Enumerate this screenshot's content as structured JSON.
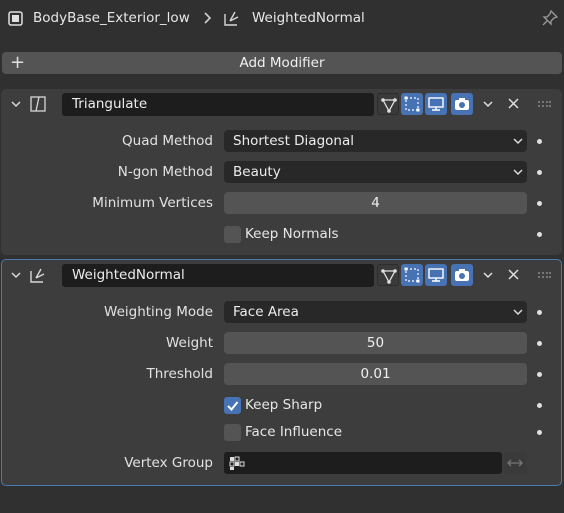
{
  "header": {
    "object_name": "BodyBase_Exterior_low",
    "modifier_name": "WeightedNormal",
    "icons": [
      "object-icon",
      "breadcrumb-chevron-icon",
      "weighted-normal-modifier-icon",
      "pin-icon"
    ]
  },
  "add_modifier": {
    "label": "Add Modifier",
    "icon": "plus-icon"
  },
  "triangulate": {
    "name": "Triangulate",
    "quad_method": {
      "label": "Quad Method",
      "value": "Shortest Diagonal"
    },
    "ngon_method": {
      "label": "N-gon Method",
      "value": "Beauty"
    },
    "min_vertices": {
      "label": "Minimum Vertices",
      "value": "4"
    },
    "keep_normals": {
      "label": "Keep Normals",
      "checked": false
    }
  },
  "weighted_normal": {
    "name": "WeightedNormal",
    "weighting_mode": {
      "label": "Weighting Mode",
      "value": "Face Area"
    },
    "weight": {
      "label": "Weight",
      "value": "50"
    },
    "threshold": {
      "label": "Threshold",
      "value": "0.01"
    },
    "keep_sharp": {
      "label": "Keep Sharp",
      "checked": true
    },
    "face_influence": {
      "label": "Face Influence",
      "checked": false
    },
    "vertex_group": {
      "label": "Vertex Group",
      "value": ""
    }
  },
  "colors": {
    "background": "#303030",
    "panel": "#3d3d3d",
    "accent": "#4772b3",
    "active_outline": "#4a78b0",
    "field_dark": "#282828",
    "field_number": "#545454"
  }
}
